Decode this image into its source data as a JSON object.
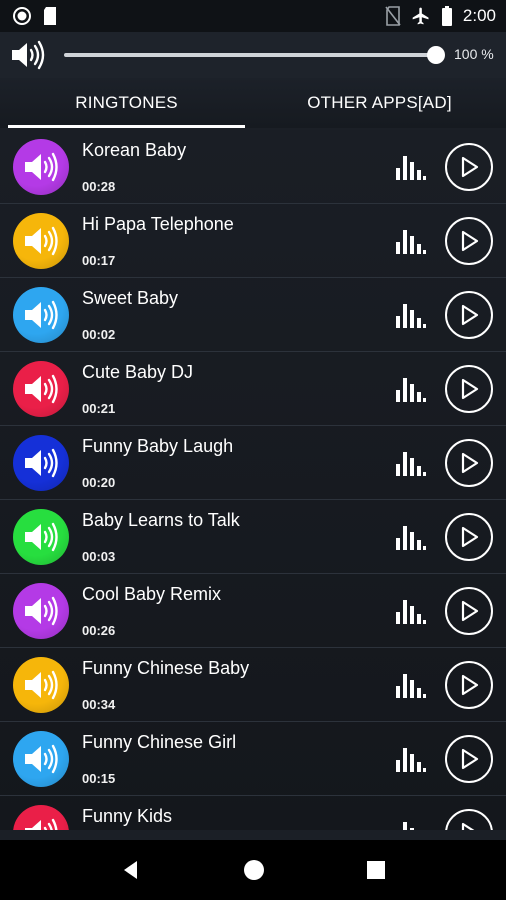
{
  "status_bar": {
    "time": "2:00",
    "icons": [
      "record-icon",
      "sd-card-icon",
      "no-sim-icon",
      "airplane-mode-icon",
      "battery-icon"
    ]
  },
  "volume": {
    "icon": "speaker-icon",
    "level_percent": 100,
    "label": "100 %"
  },
  "tabs": [
    {
      "label": "RINGTONES",
      "active": true
    },
    {
      "label": "OTHER APPS[AD]",
      "active": false
    }
  ],
  "ringtones": [
    {
      "title": "Korean Baby",
      "duration": "00:28",
      "color": "#b43ae6"
    },
    {
      "title": "Hi Papa Telephone",
      "duration": "00:17",
      "color": "#f6b60a"
    },
    {
      "title": "Sweet Baby",
      "duration": "00:02",
      "color": "#2ea6f0"
    },
    {
      "title": "Cute Baby DJ",
      "duration": "00:21",
      "color": "#ea1f48"
    },
    {
      "title": "Funny Baby Laugh",
      "duration": "00:20",
      "color": "#1530d8"
    },
    {
      "title": "Baby Learns to Talk",
      "duration": "00:03",
      "color": "#27de3f"
    },
    {
      "title": "Cool Baby Remix",
      "duration": "00:26",
      "color": "#b43ae6"
    },
    {
      "title": "Funny Chinese Baby",
      "duration": "00:34",
      "color": "#f6b60a"
    },
    {
      "title": "Funny Chinese Girl",
      "duration": "00:15",
      "color": "#2ea6f0"
    },
    {
      "title": "Funny Kids",
      "duration": "",
      "color": "#ea1f48"
    }
  ],
  "nav": {
    "icons": [
      "back-icon",
      "home-icon",
      "recents-icon"
    ]
  }
}
